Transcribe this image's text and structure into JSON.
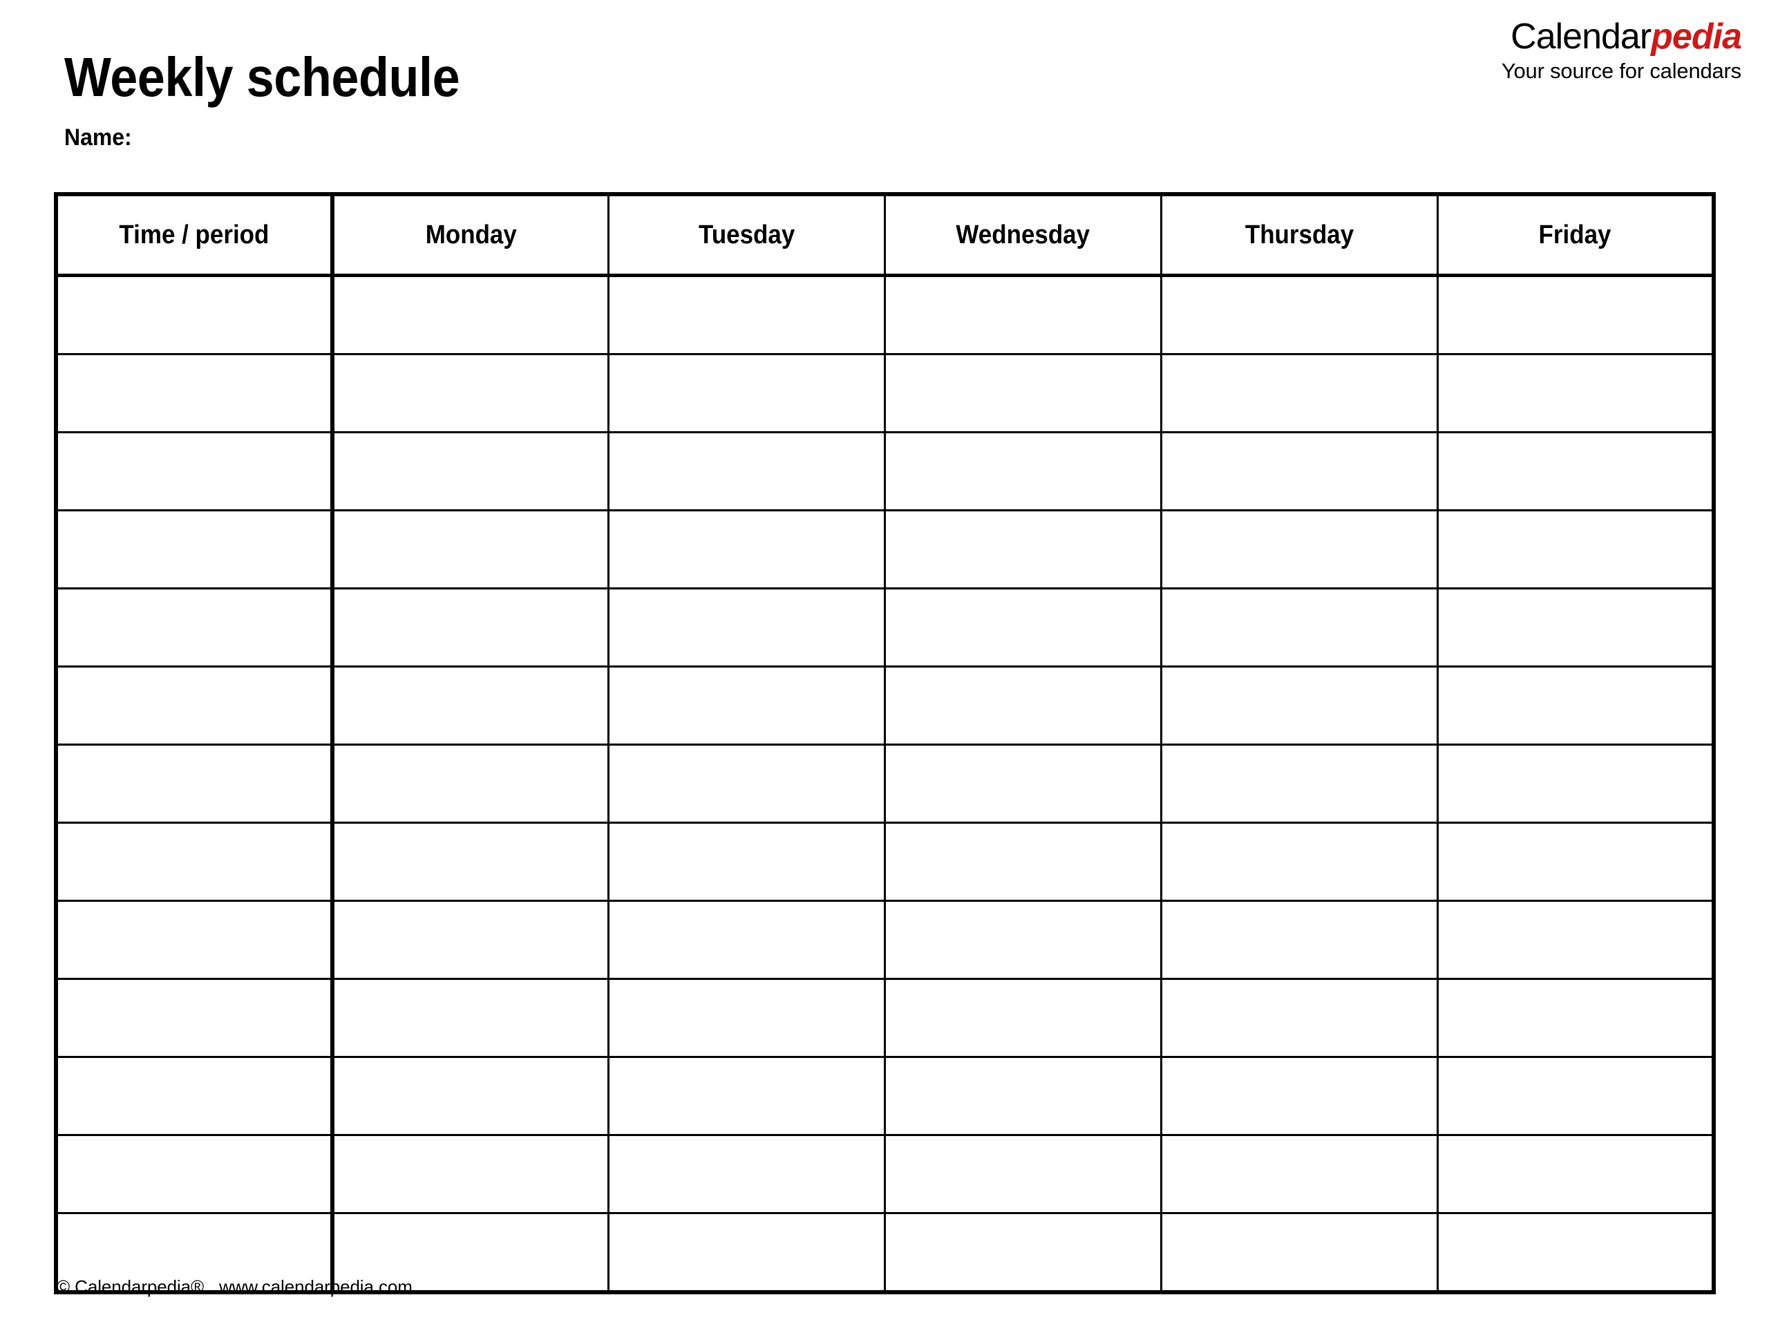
{
  "document": {
    "title": "Weekly schedule",
    "name_label": "Name:"
  },
  "brand": {
    "word_black": "Calendar",
    "word_red": "pedia",
    "tagline": "Your source for calendars",
    "accent_color": "#CC1A1A",
    "text_color": "#000000"
  },
  "table": {
    "columns": [
      {
        "key": "time",
        "label": "Time / period"
      },
      {
        "key": "monday",
        "label": "Monday"
      },
      {
        "key": "tuesday",
        "label": "Tuesday"
      },
      {
        "key": "wednesday",
        "label": "Wednesday"
      },
      {
        "key": "thursday",
        "label": "Thursday"
      },
      {
        "key": "friday",
        "label": "Friday"
      }
    ],
    "row_count": 13,
    "rows": [
      {
        "time": "",
        "monday": "",
        "tuesday": "",
        "wednesday": "",
        "thursday": "",
        "friday": ""
      },
      {
        "time": "",
        "monday": "",
        "tuesday": "",
        "wednesday": "",
        "thursday": "",
        "friday": ""
      },
      {
        "time": "",
        "monday": "",
        "tuesday": "",
        "wednesday": "",
        "thursday": "",
        "friday": ""
      },
      {
        "time": "",
        "monday": "",
        "tuesday": "",
        "wednesday": "",
        "thursday": "",
        "friday": ""
      },
      {
        "time": "",
        "monday": "",
        "tuesday": "",
        "wednesday": "",
        "thursday": "",
        "friday": ""
      },
      {
        "time": "",
        "monday": "",
        "tuesday": "",
        "wednesday": "",
        "thursday": "",
        "friday": ""
      },
      {
        "time": "",
        "monday": "",
        "tuesday": "",
        "wednesday": "",
        "thursday": "",
        "friday": ""
      },
      {
        "time": "",
        "monday": "",
        "tuesday": "",
        "wednesday": "",
        "thursday": "",
        "friday": ""
      },
      {
        "time": "",
        "monday": "",
        "tuesday": "",
        "wednesday": "",
        "thursday": "",
        "friday": ""
      },
      {
        "time": "",
        "monday": "",
        "tuesday": "",
        "wednesday": "",
        "thursday": "",
        "friday": ""
      },
      {
        "time": "",
        "monday": "",
        "tuesday": "",
        "wednesday": "",
        "thursday": "",
        "friday": ""
      },
      {
        "time": "",
        "monday": "",
        "tuesday": "",
        "wednesday": "",
        "thursday": "",
        "friday": ""
      },
      {
        "time": "",
        "monday": "",
        "tuesday": "",
        "wednesday": "",
        "thursday": "",
        "friday": ""
      }
    ]
  },
  "footer": {
    "copyright": "© Calendarpedia®",
    "website": "www.calendarpedia.com"
  }
}
